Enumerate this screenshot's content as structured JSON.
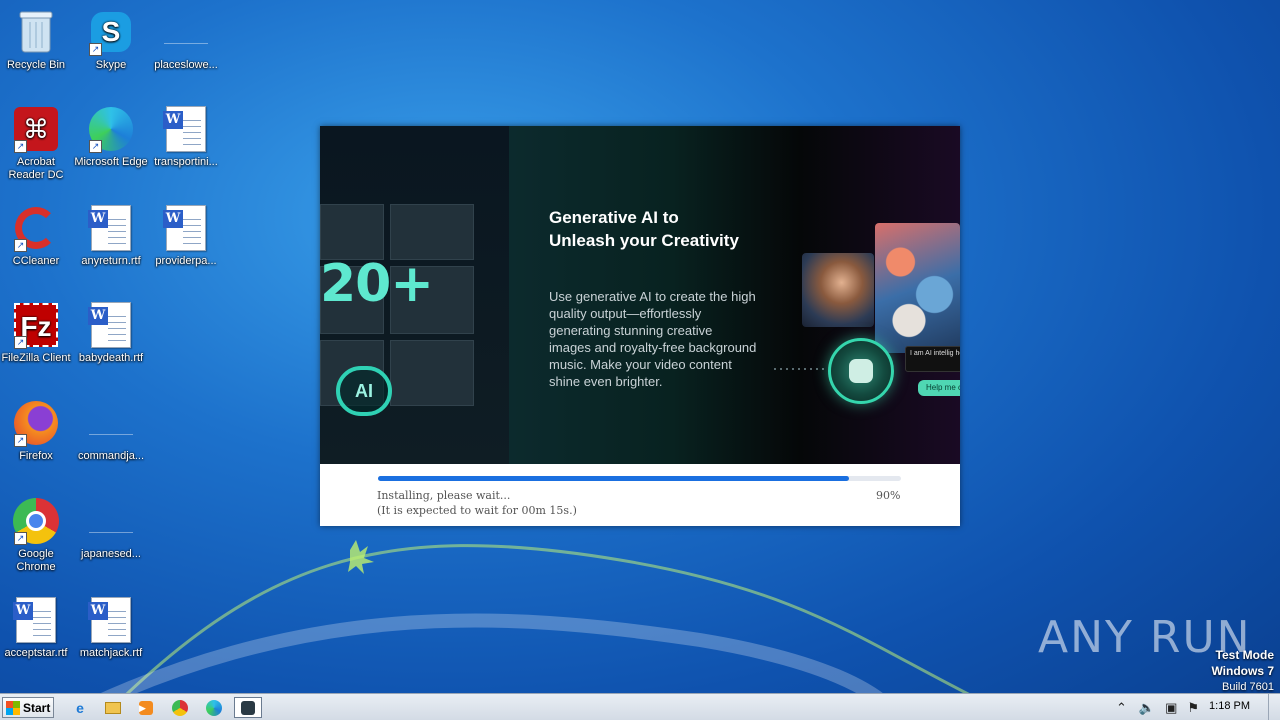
{
  "desktop": {
    "icons": [
      {
        "label": "Recycle Bin"
      },
      {
        "label": "Skype"
      },
      {
        "label": "placeslowe..."
      },
      {
        "label": "Acrobat Reader DC"
      },
      {
        "label": "Microsoft Edge"
      },
      {
        "label": "transportini..."
      },
      {
        "label": "CCleaner"
      },
      {
        "label": "anyreturn.rtf"
      },
      {
        "label": "providerpa..."
      },
      {
        "label": "FileZilla Client"
      },
      {
        "label": "babydeath.rtf"
      },
      {
        "label": "Firefox"
      },
      {
        "label": "commandja..."
      },
      {
        "label": "Google Chrome"
      },
      {
        "label": "japanesed..."
      },
      {
        "label": "acceptstar.rtf"
      },
      {
        "label": "matchjack.rtf"
      }
    ]
  },
  "installer": {
    "big_number": "20+",
    "ai_badge": "AI",
    "headline": "Generative AI to Unleash your Creativity",
    "body": "Use generative AI to create the high quality output—effortlessly generating stunning creative images and royalty-free background music. Make your video content shine even brighter.",
    "chat_text": "I am AI intellig how can I help",
    "help_button": "Help me c",
    "progress_fraction": 0.9,
    "status_line1": "Installing, please wait...",
    "status_line2": "(It is expected to wait for 00m 15s.)",
    "percent_label": "90%"
  },
  "watermark": {
    "brand": "ANY RUN",
    "test_mode": "Test Mode",
    "os": "Windows 7",
    "build": "Build 7601"
  },
  "taskbar": {
    "start_label": "Start",
    "clock": "1:18 PM"
  },
  "colors": {
    "accent": "#1a6fe0",
    "teal": "#5ee8cf"
  }
}
